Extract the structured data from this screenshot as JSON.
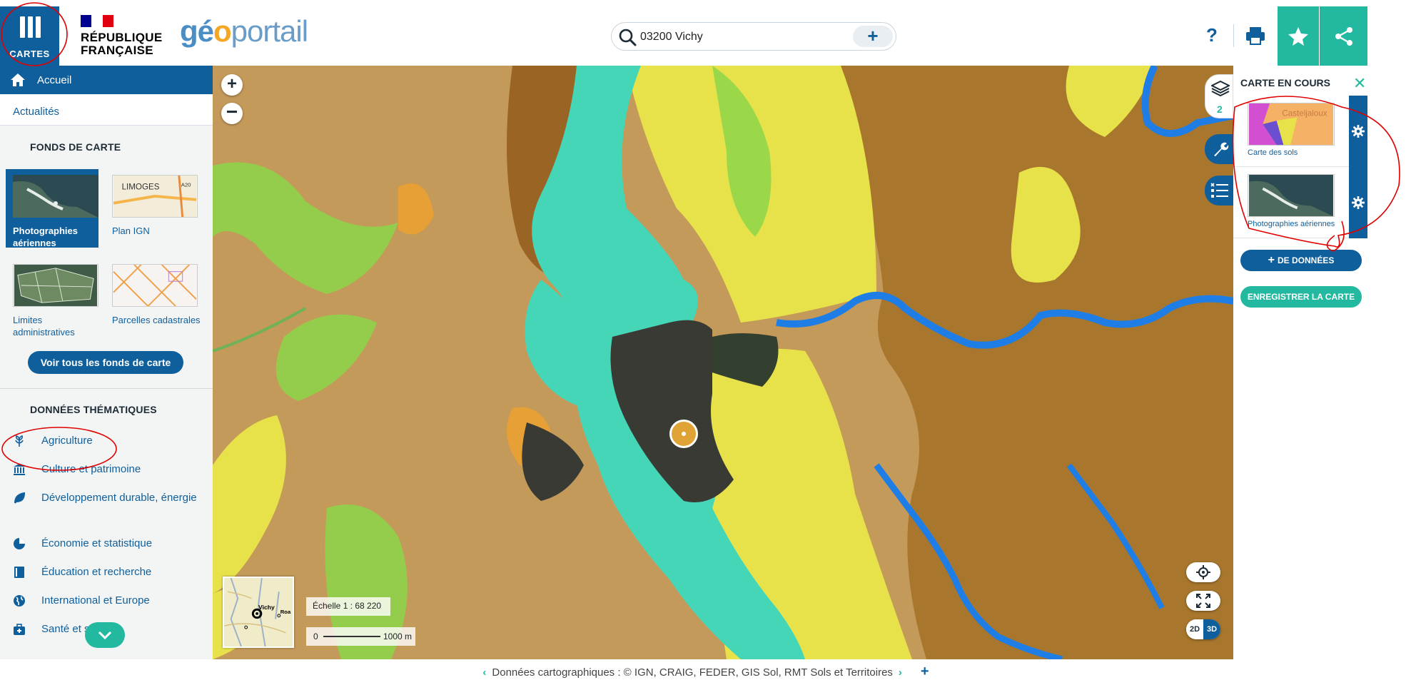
{
  "header": {
    "cartes_label": "CARTES",
    "rf_line1": "RÉPUBLIQUE",
    "rf_line2": "FRANÇAISE",
    "logo_part1": "gé",
    "logo_part2": "o",
    "logo_part3": "portail",
    "search_value": "03200 Vichy",
    "help_label": "?"
  },
  "sidebar": {
    "accueil": "Accueil",
    "actualites": "Actualités",
    "fonds_title": "FONDS DE CARTE",
    "fonds": [
      {
        "label": "Photographies aériennes"
      },
      {
        "label": "Plan IGN"
      },
      {
        "label": "Limites administratives"
      },
      {
        "label": "Parcelles cadastrales"
      }
    ],
    "voir_tous": "Voir tous les fonds de carte",
    "themes_title": "DONNÉES THÉMATIQUES",
    "themes": [
      {
        "label": "Agriculture",
        "icon": "wheat-icon"
      },
      {
        "label": "Culture et patrimoine",
        "icon": "museum-icon"
      },
      {
        "label": "Développement durable, énergie",
        "icon": "leaf-icon"
      },
      {
        "label": "Économie et statistique",
        "icon": "pie-chart-icon"
      },
      {
        "label": "Éducation et recherche",
        "icon": "book-icon"
      },
      {
        "label": "International et Europe",
        "icon": "globe-icon"
      },
      {
        "label": "Santé et social",
        "icon": "medkit-icon"
      }
    ]
  },
  "map": {
    "tile_label_limoges": "LIMOGES",
    "tile_label_a20": "A20",
    "scale_text": "Échelle 1 : 68 220",
    "scale_zero": "0",
    "scale_dist": "1000 m",
    "layer_count": "2",
    "mini_vichy": "Vichy",
    "mini_roa": "Roa",
    "btn_2d": "2D",
    "btn_3d": "3D",
    "thumb_casteljaloux": "Casteljaloux"
  },
  "panel": {
    "title": "CARTE EN COURS",
    "layers": [
      {
        "name": "Carte des sols"
      },
      {
        "name": "Photographies aériennes"
      }
    ],
    "add_data": "DE DONNÉES",
    "save_map": "ENREGISTRER LA CARTE"
  },
  "footer": {
    "attribution": "Données cartographiques : © IGN,  CRAIG,  FEDER,  GIS Sol,  RMT Sols et Territoires"
  },
  "colors": {
    "primary": "#0f5f9c",
    "accent": "#23b9a1",
    "annotation": "#e00000"
  }
}
